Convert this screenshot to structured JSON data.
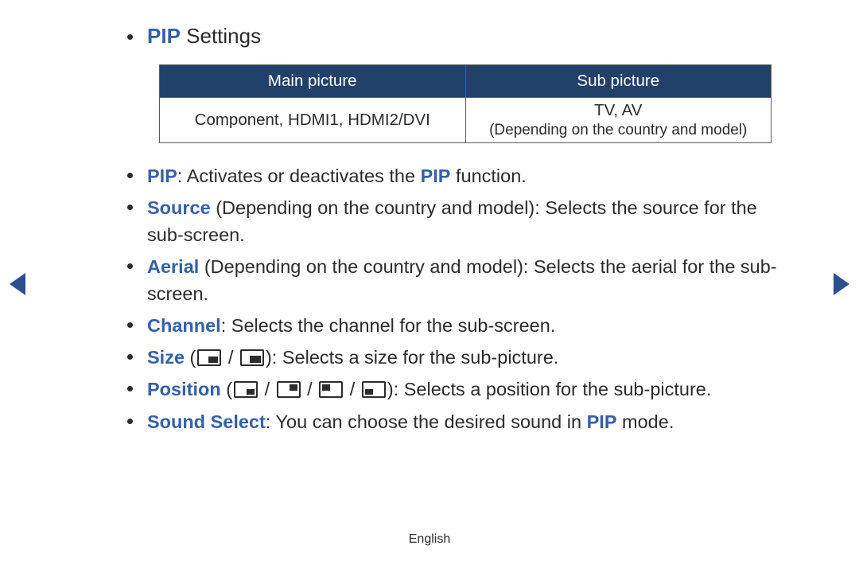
{
  "title": {
    "hl": "PIP",
    "rest": " Settings"
  },
  "table": {
    "headers": [
      "Main picture",
      "Sub picture"
    ],
    "row": {
      "main": "Component, HDMI1, HDMI2/DVI",
      "sub_line1": "TV, AV",
      "sub_line2": "(Depending on the country and model)"
    }
  },
  "items": {
    "pip": {
      "hl1": "PIP",
      "t1": ": Activates or deactivates the ",
      "hl2": "PIP",
      "t2": " function."
    },
    "source": {
      "hl": "Source",
      "t": " (Depending on the country and model): Selects the source for the sub-screen."
    },
    "aerial": {
      "hl": "Aerial",
      "t": " (Depending on the country and model): Selects the aerial for the sub-screen."
    },
    "channel": {
      "hl": "Channel",
      "t": ": Selects the channel for the sub-screen."
    },
    "size": {
      "hl": "Size",
      "open": " (",
      "sep": " / ",
      "close": "): Selects a size for the sub-picture."
    },
    "position": {
      "hl": "Position",
      "open": " (",
      "sep": " / ",
      "close": "): Selects a position for the sub-picture."
    },
    "sound": {
      "hl1": "Sound Select",
      "t1": ": You can choose the desired sound in ",
      "hl2": "PIP",
      "t2": " mode."
    }
  },
  "footer": "English"
}
